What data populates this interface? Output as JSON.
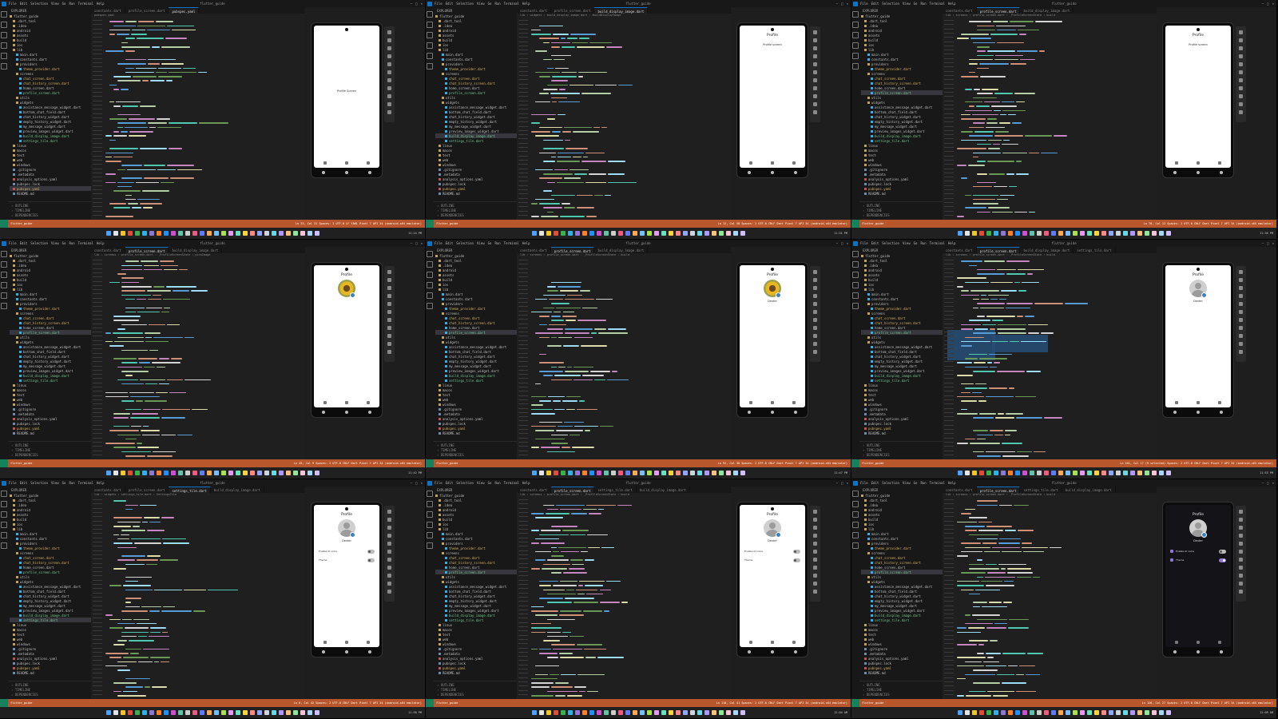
{
  "app": {
    "window_title": "flutter_guide",
    "menu": [
      "File",
      "Edit",
      "Selection",
      "View",
      "Go",
      "Run",
      "Terminal",
      "Help"
    ],
    "explorer_header": "EXPLORER",
    "project": "FLUTTER_GUIDE",
    "outline_labels": [
      "OUTLINE",
      "TIMELINE",
      "DEPENDENCIES"
    ],
    "window_controls": [
      "–",
      "□",
      "✕"
    ]
  },
  "colors": {
    "accent": "#0a74c9",
    "status_bar": "#b8572b",
    "remote_indicator": "#16825d",
    "dart_file": "#2fb0e8",
    "toggle_on": "#8f77d8"
  },
  "tree_default": [
    {
      "t": "flutter_guide",
      "k": "folder"
    },
    {
      "t": ".dart_tool",
      "k": "folder"
    },
    {
      "t": ".idea",
      "k": "folder"
    },
    {
      "t": "android",
      "k": "folder"
    },
    {
      "t": "assets",
      "k": "folder"
    },
    {
      "t": "build",
      "k": "folder"
    },
    {
      "t": "ios",
      "k": "folder"
    },
    {
      "t": "lib",
      "k": "folder"
    },
    {
      "t": "main.dart",
      "k": "dart"
    },
    {
      "t": "constants.dart",
      "k": "dart"
    },
    {
      "t": "providers",
      "k": "folder"
    },
    {
      "t": "theme_provider.dart",
      "k": "dart",
      "s": "mod"
    },
    {
      "t": "screens",
      "k": "folder"
    },
    {
      "t": "chat_screen.dart",
      "k": "dart",
      "s": "mod"
    },
    {
      "t": "chat_history_screen.dart",
      "k": "dart",
      "s": "mod"
    },
    {
      "t": "home_screen.dart",
      "k": "dart"
    },
    {
      "t": "profile_screen.dart",
      "k": "dart",
      "s": "new"
    },
    {
      "t": "utils",
      "k": "folder"
    },
    {
      "t": "widgets",
      "k": "folder"
    },
    {
      "t": "assistance_message_widget.dart",
      "k": "dart"
    },
    {
      "t": "bottom_chat_field.dart",
      "k": "dart"
    },
    {
      "t": "chat_history_widget.dart",
      "k": "dart"
    },
    {
      "t": "empty_history_widget.dart",
      "k": "dart"
    },
    {
      "t": "my_message_widget.dart",
      "k": "dart"
    },
    {
      "t": "preview_images_widget.dart",
      "k": "dart"
    },
    {
      "t": "build_display_image.dart",
      "k": "dart",
      "s": "new"
    },
    {
      "t": "settings_tile.dart",
      "k": "dart",
      "s": "new"
    },
    {
      "t": "linux",
      "k": "folder"
    },
    {
      "t": "macos",
      "k": "folder"
    },
    {
      "t": "test",
      "k": "folder"
    },
    {
      "t": "web",
      "k": "folder"
    },
    {
      "t": "windows",
      "k": "folder"
    },
    {
      "t": ".gitignore",
      "k": "file"
    },
    {
      "t": ".metadata",
      "k": "file"
    },
    {
      "t": "analysis_options.yaml",
      "k": "yaml"
    },
    {
      "t": "pubspec.lock",
      "k": "file"
    },
    {
      "t": "pubspec.yaml",
      "k": "yaml",
      "s": "mod"
    },
    {
      "t": "README.md",
      "k": "file"
    }
  ],
  "panes": [
    {
      "tabs": [
        "constants.dart",
        "profile_screen.dart",
        "pubspec.yaml"
      ],
      "active_tab": 2,
      "crumbs": "pubspec.yaml",
      "selected_file": "pubspec.yaml",
      "screen": {
        "kind": "text",
        "title": "",
        "text": "Profile Screen",
        "theme": "light"
      },
      "status_left": "flutter_guide",
      "status_right": "Ln 33, Col 31  Spaces: 2  UTF-8  LF  YAML  Pixel 7 API 34 (android-x64 emulator)",
      "clock": "11:24 PM"
    },
    {
      "tabs": [
        "constants.dart",
        "profile_screen.dart",
        "build_display_image.dart"
      ],
      "active_tab": 2,
      "crumbs": "lib › widgets › build_display_image.dart › BuildDisplayImage",
      "selected_file": "build_display_image.dart",
      "screen": {
        "kind": "text",
        "title": "Profile",
        "text": "Profile screen",
        "theme": "light"
      },
      "status_left": "flutter_guide",
      "status_right": "Ln 12, Col 58  Spaces: 2  UTF-8  CRLF  Dart  Pixel 7 API 34 (android-x64 emulator)",
      "clock": "11:31 PM"
    },
    {
      "tabs": [
        "constants.dart",
        "profile_screen.dart",
        "build_display_image.dart"
      ],
      "active_tab": 1,
      "crumbs": "lib › screens › profile_screen.dart › _ProfileScreenState › build",
      "selected_file": "profile_screen.dart",
      "screen": {
        "kind": "text",
        "title": "Profile",
        "text": "Profile screen",
        "theme": "light"
      },
      "status_left": "flutter_guide",
      "status_right": "Ln 78, Col 12  Spaces: 2  UTF-8  CRLF  Dart  Pixel 7 API 34 (android-x64 emulator)",
      "clock": "11:36 PM"
    },
    {
      "tabs": [
        "constants.dart",
        "profile_screen.dart",
        "build_display_image.dart"
      ],
      "active_tab": 1,
      "crumbs": "lib › screens › profile_screen.dart › _ProfileScreenState › pickImage",
      "selected_file": "profile_screen.dart",
      "screen": {
        "kind": "avatar",
        "title": "Profile",
        "avatar": "flower",
        "name": "",
        "theme": "light"
      },
      "status_left": "flutter_guide",
      "status_right": "Ln 45, Col 9  Spaces: 2  UTF-8  CRLF  Dart  Pixel 7 API 34 (android-x64 emulator)",
      "clock": "11:42 PM"
    },
    {
      "tabs": [
        "constants.dart",
        "profile_screen.dart",
        "build_display_image.dart"
      ],
      "active_tab": 1,
      "crumbs": "lib › screens › profile_screen.dart › _ProfileScreenState › build",
      "selected_file": "profile_screen.dart",
      "screen": {
        "kind": "avatar",
        "title": "Profile",
        "avatar": "flower",
        "name": "Dexter",
        "theme": "light"
      },
      "status_left": "flutter_guide",
      "status_right": "Ln 92, Col 30  Spaces: 2  UTF-8  CRLF  Dart  Pixel 7 API 34 (android-x64 emulator)",
      "clock": "11:47 PM"
    },
    {
      "tabs": [
        "constants.dart",
        "profile_screen.dart",
        "build_display_image.dart",
        "settings_tile.dart"
      ],
      "active_tab": 1,
      "crumbs": "lib › screens › profile_screen.dart › _ProfileScreenState › build",
      "selected_file": "profile_screen.dart",
      "screen": {
        "kind": "avatar",
        "title": "Profile",
        "avatar": "default",
        "name": "Dexter",
        "theme": "light"
      },
      "status_left": "flutter_guide",
      "status_right": "Ln 101, Col 17 (9 selected)  Spaces: 2  UTF-8  CRLF  Dart  Pixel 7 API 34 (android-x64 emulator)",
      "clock": "11:53 PM"
    },
    {
      "tabs": [
        "constants.dart",
        "profile_screen.dart",
        "settings_tile.dart",
        "build_display_image.dart"
      ],
      "active_tab": 2,
      "crumbs": "lib › widgets › settings_tile.dart › SettingsTile",
      "selected_file": "settings_tile.dart",
      "screen": {
        "kind": "settings",
        "title": "Profile",
        "avatar": "default",
        "name": "Dexter",
        "theme": "light",
        "settings": [
          {
            "label": "Enable AI voice",
            "on": false
          },
          {
            "label": "Theme",
            "on": false
          }
        ]
      },
      "status_left": "flutter_guide",
      "status_right": "Ln 6, Col 42  Spaces: 2  UTF-8  CRLF  Dart  Pixel 7 API 34 (android-x64 emulator)",
      "clock": "11:58 PM"
    },
    {
      "tabs": [
        "constants.dart",
        "profile_screen.dart",
        "settings_tile.dart",
        "build_display_image.dart"
      ],
      "active_tab": 1,
      "crumbs": "lib › screens › profile_screen.dart › _ProfileScreenState › build",
      "selected_file": "profile_screen.dart",
      "screen": {
        "kind": "settings",
        "title": "Profile",
        "avatar": "default",
        "name": "Dexter",
        "theme": "light",
        "settings": [
          {
            "label": "Enable AI voice",
            "on": false
          },
          {
            "label": "Theme",
            "on": false
          }
        ]
      },
      "status_left": "flutter_guide",
      "status_right": "Ln 118, Col 41  Spaces: 2  UTF-8  CRLF  Dart  Pixel 7 API 34 (android-x64 emulator)",
      "clock": "12:04 AM"
    },
    {
      "tabs": [
        "constants.dart",
        "profile_screen.dart",
        "settings_tile.dart",
        "build_display_image.dart"
      ],
      "active_tab": 1,
      "crumbs": "lib › screens › profile_screen.dart › _ProfileScreenState › build",
      "selected_file": "profile_screen.dart",
      "screen": {
        "kind": "settings",
        "title": "Profile",
        "avatar": "default",
        "name": "Dexter",
        "theme": "dark",
        "settings": [
          {
            "label": "Enable AI voice",
            "on": false
          },
          {
            "label": "Theme",
            "on": true
          }
        ]
      },
      "status_left": "flutter_guide",
      "status_right": "Ln 126, Col 27  Spaces: 2  UTF-8  CRLF  Dart  Pixel 7 API 34 (android-x64 emulator)",
      "clock": "12:09 AM"
    }
  ]
}
